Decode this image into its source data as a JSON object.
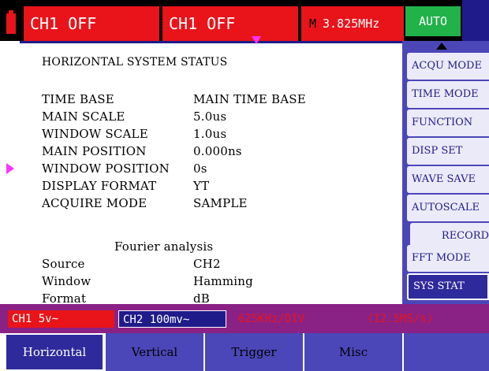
{
  "top_bar": {
    "ch1_status": "CH1 OFF",
    "ch1_status_2": "CH1 OFF",
    "freq_prefix": "M",
    "frequency": "3.825MHz",
    "trigger_mode": "AUTO"
  },
  "panel": {
    "title": "HORIZONTAL SYSTEM STATUS",
    "rows": [
      {
        "label": "TIME BASE",
        "value": "MAIN TIME BASE"
      },
      {
        "label": "MAIN SCALE",
        "value": "5.0us"
      },
      {
        "label": "WINDOW SCALE",
        "value": "1.0us"
      },
      {
        "label": "MAIN POSITION",
        "value": "0.000ns"
      },
      {
        "label": "WINDOW POSITION",
        "value": "0s"
      },
      {
        "label": "DISPLAY FORMAT",
        "value": "YT"
      },
      {
        "label": "ACQUIRE MODE",
        "value": "SAMPLE"
      }
    ],
    "fourier_title": "Fourier analysis",
    "fourier_rows": [
      {
        "label": "Source",
        "value": "CH2"
      },
      {
        "label": "Window",
        "value": "Hamming"
      },
      {
        "label": "Format",
        "value": "dB"
      }
    ]
  },
  "right_menu": {
    "items": [
      {
        "label": "ACQU MODE"
      },
      {
        "label": "TIME MODE"
      },
      {
        "label": "FUNCTION"
      },
      {
        "label": "DISP SET"
      },
      {
        "label": "WAVE SAVE"
      },
      {
        "label": "AUTOSCALE"
      },
      {
        "label": "RECORD"
      },
      {
        "label": "FFT MODE"
      },
      {
        "label": "SYS STAT"
      }
    ],
    "active": "SYS STAT"
  },
  "status_strip": {
    "ch1_scale": "CH1 5v~",
    "ch2_scale": "CH2 100mv~",
    "timebase": "625KHz/DIV",
    "sample_rate": "(12.5MS/s)"
  },
  "tabs": {
    "items": [
      {
        "label": "Horizontal"
      },
      {
        "label": "Vertical"
      },
      {
        "label": "Trigger"
      },
      {
        "label": "Misc"
      },
      {
        "label": ""
      }
    ],
    "active": "Horizontal"
  },
  "colors": {
    "channel_red": "#e8141a",
    "menu_blue": "#4b47b8",
    "active_blue": "#2e2a9c",
    "status_purple": "#8a2286",
    "auto_green": "#21b24a",
    "marker_magenta": "#ff33ff"
  }
}
